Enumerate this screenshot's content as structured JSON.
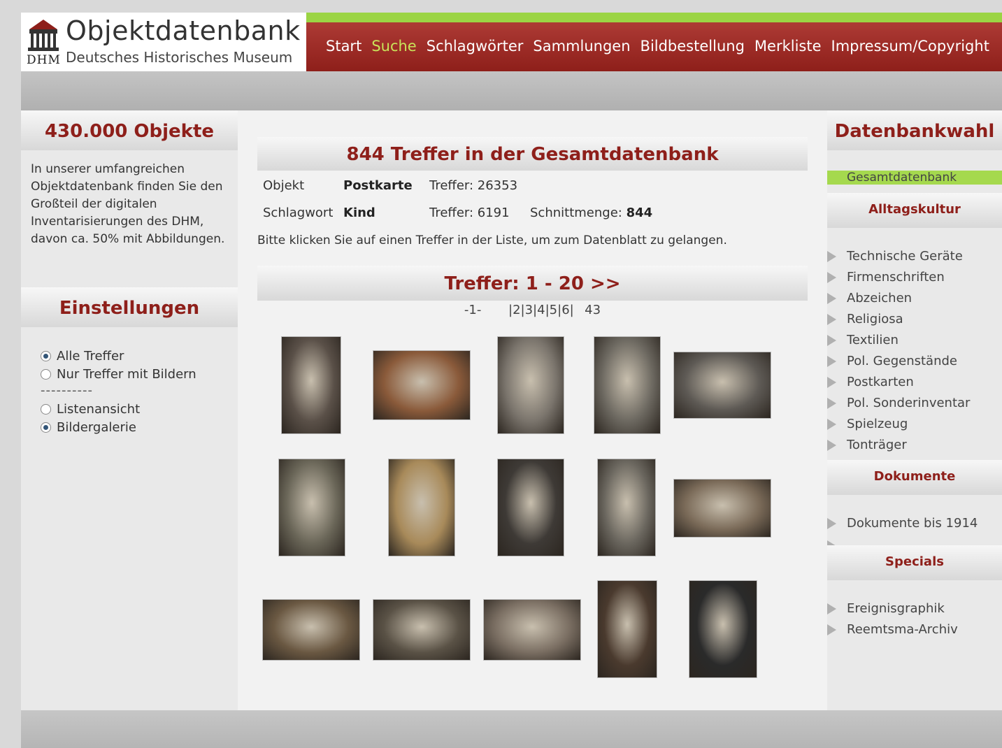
{
  "header": {
    "logo_title": "Objektdatenbank",
    "logo_initials": "DHM",
    "logo_subtitle": "Deutsches Historisches Museum",
    "nav": [
      {
        "label": "Start",
        "active": false
      },
      {
        "label": "Suche",
        "active": true
      },
      {
        "label": "Schlagwörter",
        "active": false
      },
      {
        "label": "Sammlungen",
        "active": false
      },
      {
        "label": "Bildbestellung",
        "active": false
      },
      {
        "label": "Merkliste",
        "active": false
      },
      {
        "label": "Impressum/Copyright",
        "active": false
      }
    ],
    "nav_active_color": "#c9e35a",
    "accent_color": "#8e1f1a",
    "green_color": "#9bd444"
  },
  "left": {
    "heading": "430.000 Objekte",
    "intro": "In unserer umfangreichen Objektdatenbank finden Sie den Großteil der digitalen Inventarisierungen des DHM, davon ca. 50% mit Abbildungen.",
    "settings_heading": "Einstellungen",
    "options": [
      {
        "label": "Alle Treffer",
        "checked": true
      },
      {
        "label": "Nur Treffer mit Bildern",
        "checked": false
      }
    ],
    "separator": "----------",
    "view_options": [
      {
        "label": "Listenansicht",
        "checked": false
      },
      {
        "label": "Bildergalerie",
        "checked": true
      }
    ]
  },
  "main": {
    "heading": "844 Treffer in der Gesamtdatenbank",
    "criteria": [
      {
        "label": "Objekt",
        "value": "Postkarte",
        "hits": "Treffer: 26353"
      },
      {
        "label": "Schlagwort",
        "value": "Kind",
        "hits": "Treffer: 6191",
        "intersection_label": "Schnittmenge:",
        "intersection_value": "844"
      }
    ],
    "hint": "Bitte klicken Sie auf einen Treffer in der Liste, um zum Datenblatt zu gelangen.",
    "results_heading": "Treffer: 1 - 20 >>",
    "pager": {
      "current": "-1-",
      "pages": [
        "2",
        "3",
        "4",
        "5",
        "6"
      ],
      "last": "43"
    },
    "thumbnails": [
      {
        "name": "thumb-child-on-chair",
        "tone": "#5a5048"
      },
      {
        "name": "thumb-christmas-tree",
        "tone": "#8a5a3a"
      },
      {
        "name": "thumb-child-sitting",
        "tone": "#7a746c"
      },
      {
        "name": "thumb-children-bed",
        "tone": "#6c6860"
      },
      {
        "name": "thumb-children-rocking-horse",
        "tone": "#5e5a55"
      },
      {
        "name": "thumb-child-with-dog",
        "tone": "#6a6658"
      },
      {
        "name": "thumb-hummel-wanderer",
        "tone": "#a88a5a"
      },
      {
        "name": "thumb-baby-with-candle",
        "tone": "#3e3a36"
      },
      {
        "name": "thumb-children-ladder",
        "tone": "#6a665e"
      },
      {
        "name": "thumb-sailor-boys",
        "tone": "#7a6a58"
      },
      {
        "name": "thumb-boys-walking",
        "tone": "#6a5842"
      },
      {
        "name": "thumb-group-on-steps",
        "tone": "#5a5246"
      },
      {
        "name": "thumb-children-garden",
        "tone": "#7a6e62"
      },
      {
        "name": "thumb-family-portrait",
        "tone": "#4a3a2e"
      },
      {
        "name": "thumb-newspaper-collage",
        "tone": "#2a2a2a"
      }
    ]
  },
  "right": {
    "heading": "Datenbankwahl",
    "active_db": "Gesamtdatenbank",
    "sections": [
      {
        "title": "Alltagskultur",
        "items": [
          "Technische Geräte",
          "Firmenschriften",
          "Abzeichen",
          "Religiosa",
          "Textilien",
          "Pol. Gegenstände",
          "Postkarten",
          "Pol. Sonderinventar",
          "Spielzeug",
          "Tonträger"
        ]
      },
      {
        "title": "Dokumente",
        "items": [
          "Dokumente bis 1914",
          "..."
        ]
      },
      {
        "title": "Specials",
        "items": [
          "Ereignisgraphik",
          "Reemtsma-Archiv"
        ]
      }
    ]
  }
}
